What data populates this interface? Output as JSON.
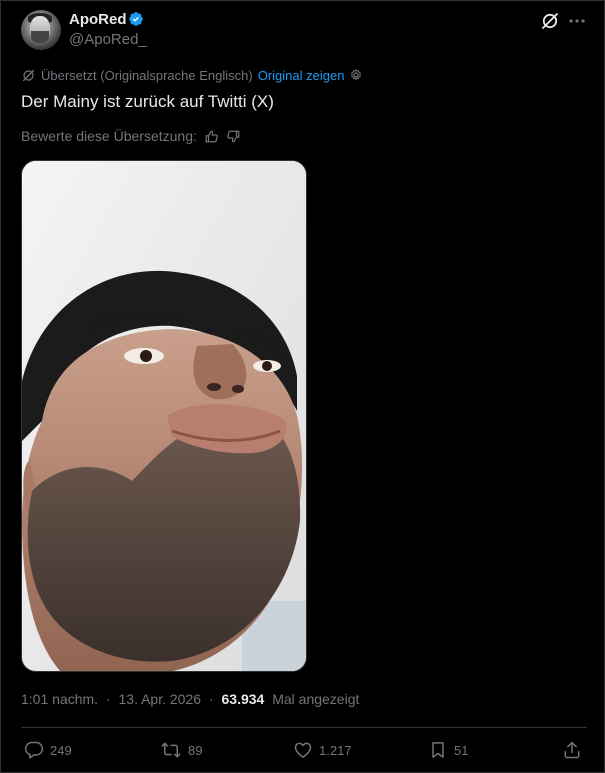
{
  "author": {
    "display_name": "ApoRed",
    "handle": "@ApoRed_",
    "verified": true,
    "verified_color": "#1d9bf0"
  },
  "translation": {
    "notice": "Übersetzt (Originalsprache Englisch)",
    "show_original": "Original zeigen",
    "rate_label": "Bewerte diese Übersetzung:"
  },
  "tweet": {
    "text": "Der Mainy ist zurück auf Twitti (X)"
  },
  "meta": {
    "time": "1:01 nachm.",
    "separator": "·",
    "date": "13. Apr. 2026",
    "views": "63.934",
    "views_label": "Mal angezeigt"
  },
  "actions": {
    "replies": "249",
    "reposts": "89",
    "likes": "1.217",
    "bookmarks": "51"
  },
  "colors": {
    "background": "#000000",
    "text": "#e7e9ea",
    "muted": "#71767b",
    "accent": "#1d9bf0",
    "border": "#2f3336"
  }
}
